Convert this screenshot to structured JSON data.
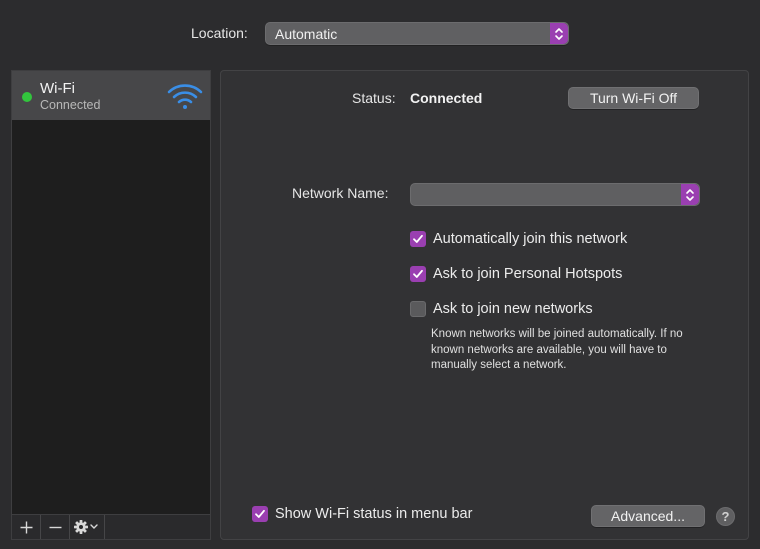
{
  "location": {
    "label": "Location:",
    "value": "Automatic"
  },
  "sidebar": {
    "items": [
      {
        "title": "Wi-Fi",
        "subtitle": "Connected",
        "status_color": "#32c53d",
        "icon": "wifi-icon"
      }
    ],
    "bottom_controls": [
      "add-icon",
      "remove-icon",
      "gear-icon"
    ]
  },
  "panel": {
    "status_label": "Status:",
    "status_value": "Connected",
    "wifi_off_button": "Turn Wi-Fi Off",
    "network_name_label": "Network Name:",
    "network_name_value": "",
    "options": [
      {
        "label": "Automatically join this network",
        "checked": true
      },
      {
        "label": "Ask to join Personal Hotspots",
        "checked": true
      },
      {
        "label": "Ask to join new networks",
        "checked": false
      }
    ],
    "help_text": "Known networks will be joined automatically. If no known networks are available, you will have to manually select a network.",
    "show_status_label": "Show Wi-Fi status in menu bar",
    "show_status_checked": true,
    "advanced_button": "Advanced...",
    "help_button": "?"
  },
  "colors": {
    "accent": "#9a3fb1",
    "wifi_blue": "#3a8ee6",
    "connected_green": "#32c53d"
  }
}
